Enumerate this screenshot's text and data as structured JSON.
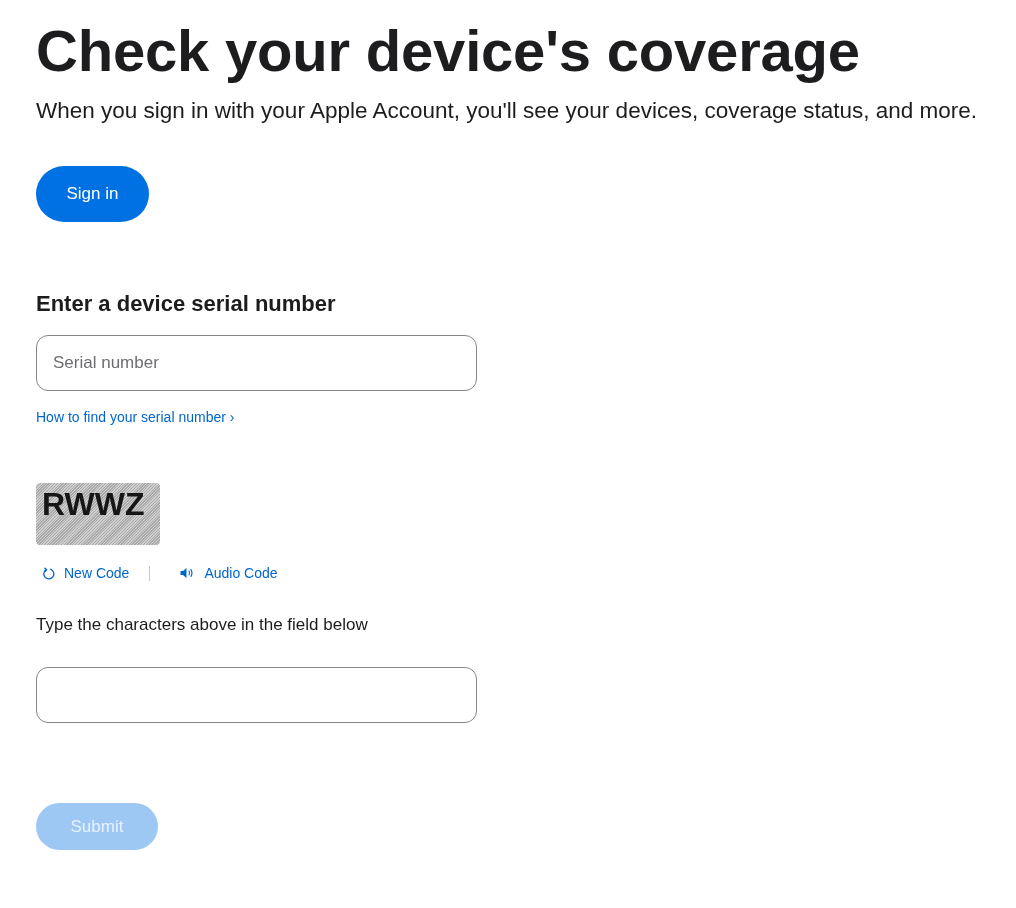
{
  "title": "Check your device's coverage",
  "intro": "When you sign in with your Apple Account, you'll see your devices, coverage status, and more.",
  "sign_in_button": {
    "label": "Sign in"
  },
  "serial_section": {
    "heading": "Enter a device serial number",
    "field": {
      "placeholder": "Serial number"
    },
    "help_link": "How to find your serial number ›"
  },
  "captcha": {
    "text": "RWWZ",
    "actions": [
      {
        "kind": "refresh",
        "label": "New Code"
      },
      {
        "kind": "audio",
        "label": "Audio Code"
      }
    ],
    "instruction": "Type the characters above in the field below"
  },
  "submit_button": {
    "label": "Submit",
    "disabled": true
  }
}
